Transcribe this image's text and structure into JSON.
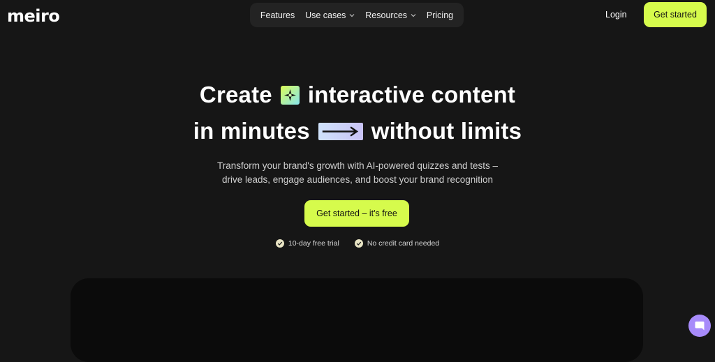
{
  "brand": {
    "logo_text": "meiro"
  },
  "nav": {
    "items": [
      {
        "label": "Features",
        "has_dropdown": false
      },
      {
        "label": "Use cases",
        "has_dropdown": true
      },
      {
        "label": "Resources",
        "has_dropdown": true
      },
      {
        "label": "Pricing",
        "has_dropdown": false
      }
    ],
    "login_label": "Login",
    "cta_label": "Get started"
  },
  "hero": {
    "line1_a": "Create",
    "line1_b": "interactive content",
    "line2_a": "in minutes",
    "line2_b": "without limits",
    "subtitle_line1": "Transform your brand's growth with AI-powered quizzes and tests –",
    "subtitle_line2": "drive leads, engage audiences, and boost your brand recognition",
    "cta_label": "Get started – it's free",
    "checks": [
      "10-day free trial",
      "No credit card needed"
    ]
  },
  "colors": {
    "background": "#161616",
    "accent": "#d6fb4c",
    "chat_bubble": "#a78bfa"
  },
  "icons": [
    "sparkle-icon",
    "arrow-right-icon",
    "chevron-down-icon",
    "check-circle-icon",
    "chat-icon"
  ]
}
